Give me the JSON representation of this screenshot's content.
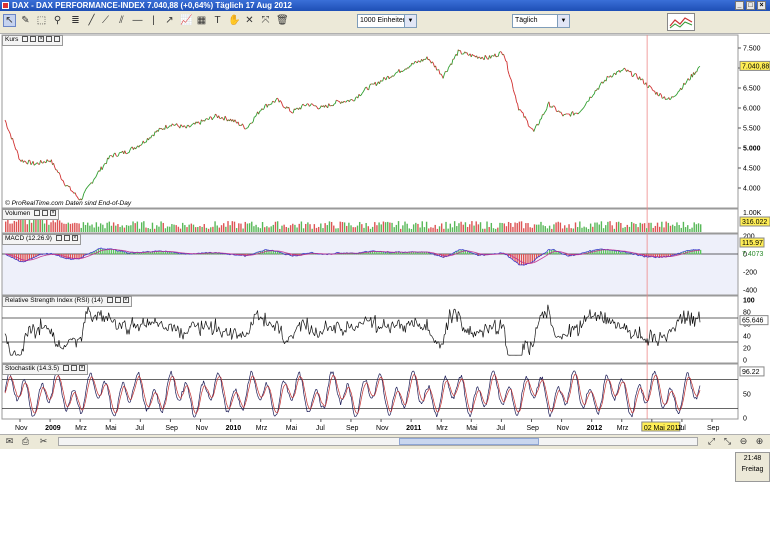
{
  "window": {
    "title": "DAX - DAX PERFORMANCE-INDEX   7.040,88 (+0,64%)   Täglich  17 Aug 2012"
  },
  "toolbar": {
    "units_select": "1000 Einheiten",
    "interval_select": "Täglich"
  },
  "panels": {
    "price": {
      "title": "Kurs",
      "watermark": "© ProRealTime.com  Daten sind End-of-Day",
      "last_value": "7.040,88",
      "ticks": [
        "7.500",
        "7.000",
        "6.500",
        "6.000",
        "5.500",
        "5.000",
        "4.500",
        "4.000"
      ]
    },
    "volume": {
      "title": "Volumen",
      "ticks": [
        "1.00K"
      ],
      "last_value": "316.022"
    },
    "macd": {
      "title": "MACD (12.26.9)",
      "ticks": [
        "200",
        "0",
        "-200",
        "-400"
      ],
      "last_value": "115.97",
      "signal_value": "7.4073"
    },
    "rsi": {
      "title": "Relative Strength Index (RSI) (14)",
      "ticks": [
        "100",
        "80",
        "60",
        "40",
        "20",
        "0"
      ],
      "last_value": "65.646"
    },
    "stoch": {
      "title": "Stochastik (14.3.5)",
      "ticks": [
        "50",
        "0"
      ],
      "last_value": "96.22"
    }
  },
  "xaxis": {
    "labels": [
      {
        "text": "Nov",
        "bold": false
      },
      {
        "text": "2009",
        "bold": true
      },
      {
        "text": "Mrz",
        "bold": false
      },
      {
        "text": "Mai",
        "bold": false
      },
      {
        "text": "Jul",
        "bold": false
      },
      {
        "text": "Sep",
        "bold": false
      },
      {
        "text": "Nov",
        "bold": false
      },
      {
        "text": "2010",
        "bold": true
      },
      {
        "text": "Mrz",
        "bold": false
      },
      {
        "text": "Mai",
        "bold": false
      },
      {
        "text": "Jul",
        "bold": false
      },
      {
        "text": "Sep",
        "bold": false
      },
      {
        "text": "Nov",
        "bold": false
      },
      {
        "text": "2011",
        "bold": true
      },
      {
        "text": "Mrz",
        "bold": false
      },
      {
        "text": "Mai",
        "bold": false
      },
      {
        "text": "Jul",
        "bold": false
      },
      {
        "text": "Sep",
        "bold": false
      },
      {
        "text": "Nov",
        "bold": false
      },
      {
        "text": "2012",
        "bold": true
      },
      {
        "text": "Mrz",
        "bold": false
      },
      {
        "text": "02 Mai 2012",
        "bold": false,
        "highlight": true
      },
      {
        "text": "Jul",
        "bold": false
      },
      {
        "text": "Sep",
        "bold": false
      }
    ]
  },
  "chart_data": {
    "type": "line",
    "title": "DAX - DAX PERFORMANCE-INDEX",
    "xlabel": "",
    "ylabel": "",
    "ylim": [
      3500,
      7750
    ],
    "x": [
      "2008-10",
      "2008-11",
      "2008-12",
      "2009-01",
      "2009-02",
      "2009-03",
      "2009-04",
      "2009-05",
      "2009-06",
      "2009-07",
      "2009-08",
      "2009-09",
      "2009-10",
      "2009-11",
      "2009-12",
      "2010-01",
      "2010-02",
      "2010-03",
      "2010-04",
      "2010-05",
      "2010-06",
      "2010-07",
      "2010-08",
      "2010-09",
      "2010-10",
      "2010-11",
      "2010-12",
      "2011-01",
      "2011-02",
      "2011-03",
      "2011-04",
      "2011-05",
      "2011-06",
      "2011-07",
      "2011-08",
      "2011-09",
      "2011-10",
      "2011-11",
      "2011-12",
      "2012-01",
      "2012-02",
      "2012-03",
      "2012-04",
      "2012-05",
      "2012-06",
      "2012-07",
      "2012-08"
    ],
    "series": [
      {
        "name": "Kurs",
        "values": [
          5700,
          4700,
          4600,
          4700,
          4100,
          3700,
          4300,
          4800,
          4900,
          5100,
          5400,
          5600,
          5500,
          5650,
          5800,
          5700,
          5500,
          6000,
          6200,
          5900,
          6100,
          6000,
          6150,
          6200,
          6500,
          6700,
          6900,
          7100,
          7250,
          6800,
          7400,
          7300,
          7250,
          7400,
          6000,
          5400,
          6100,
          5800,
          5900,
          6400,
          6800,
          6950,
          6750,
          6400,
          6200,
          6600,
          7040
        ]
      }
    ],
    "volume_scale": 1000,
    "highlight_date": "2012-05-02"
  }
}
